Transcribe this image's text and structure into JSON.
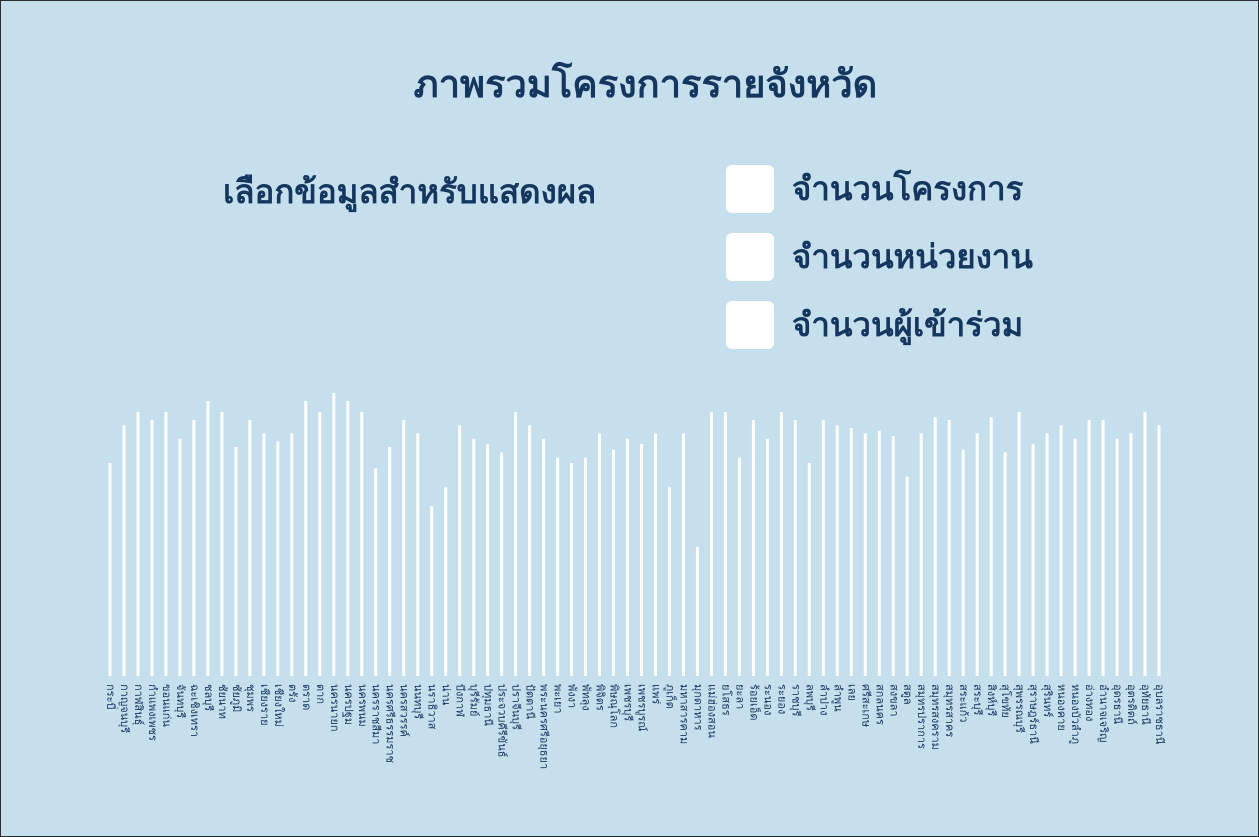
{
  "title": "ภาพรวมโครงการรายจังหวัด",
  "selector": {
    "label": "เลือกข้อมูลสำหรับแสดงผล",
    "options": [
      {
        "label": "จำนวนโครงการ",
        "checked": false
      },
      {
        "label": "จำนวนหน่วยงาน",
        "checked": false
      },
      {
        "label": "จำนวนผู้เข้าร่วม",
        "checked": false
      }
    ]
  },
  "colors": {
    "background": "#c5dfed",
    "text": "#15365e",
    "bar": "#ffffff",
    "checkbox": "#ffffff"
  },
  "chart_data": {
    "type": "bar",
    "title": "",
    "xlabel": "",
    "ylabel": "",
    "y_axis_shown": false,
    "grid": false,
    "categories": [
      "กระบี่",
      "กาญจนบุรี",
      "กาฬสินธุ์",
      "กำแพงเพชร",
      "ขอนแก่น",
      "จันทบุรี",
      "ฉะเชิงเทรา",
      "ชลบุรี",
      "ชัยนาท",
      "ชัยภูมิ",
      "ชุมพร",
      "เชียงราย",
      "เชียงใหม่",
      "ตรัง",
      "ตราด",
      "ตาก",
      "นครนายก",
      "นครปฐม",
      "นครพนม",
      "นครราชสีมา",
      "นครศรีธรรมราช",
      "นครสวรรค์",
      "นนทบุรี",
      "นราธิวาส",
      "น่าน",
      "บึงกาฬ",
      "บุรีรัมย์",
      "ปทุมธานี",
      "ประจวบคีรีขันธ์",
      "ปราจีนบุรี",
      "ปัตตานี",
      "พระนครศรีอยุธยา",
      "พะเยา",
      "พังงา",
      "พัทลุง",
      "พิจิตร",
      "พิษณุโลก",
      "เพชรบุรี",
      "เพชรบูรณ์",
      "แพร่",
      "ภูเก็ต",
      "มหาสารคาม",
      "มุกดาหาร",
      "แม่ฮ่องสอน",
      "ยโสธร",
      "ยะลา",
      "ร้อยเอ็ด",
      "ระนอง",
      "ระยอง",
      "ราชบุรี",
      "ลพบุรี",
      "ลำปาง",
      "ลำพูน",
      "เลย",
      "ศรีสะเกษ",
      "สกลนคร",
      "สงขลา",
      "สตูล",
      "สมุทรปราการ",
      "สมุทรสงคราม",
      "สมุทรสาคร",
      "สระแก้ว",
      "สระบุรี",
      "สิงห์บุรี",
      "สุโขทัย",
      "สุพรรณบุรี",
      "สุราษฎร์ธานี",
      "สุรินทร์",
      "หนองคาย",
      "หนองบัวลำภู",
      "อ่างทอง",
      "อำนาจเจริญ",
      "อุดรธานี",
      "อุตรดิตถ์",
      "อุทัยธานี",
      "อุบลราชธานี"
    ],
    "values": [
      79,
      93,
      98,
      95,
      98,
      88,
      95,
      102,
      98,
      85,
      95,
      90,
      87,
      90,
      102,
      98,
      105,
      102,
      98,
      77,
      85,
      95,
      90,
      63,
      70,
      93,
      88,
      86,
      83,
      98,
      93,
      88,
      81,
      79,
      81,
      90,
      84,
      88,
      86,
      90,
      70,
      90,
      48,
      98,
      98,
      81,
      95,
      88,
      98,
      95,
      79,
      95,
      93,
      92,
      90,
      91,
      89,
      74,
      90,
      96,
      95,
      84,
      90,
      96,
      83,
      98,
      86,
      90,
      93,
      88,
      95,
      95,
      88,
      90,
      98,
      93
    ],
    "ylim": [
      0,
      115
    ]
  }
}
